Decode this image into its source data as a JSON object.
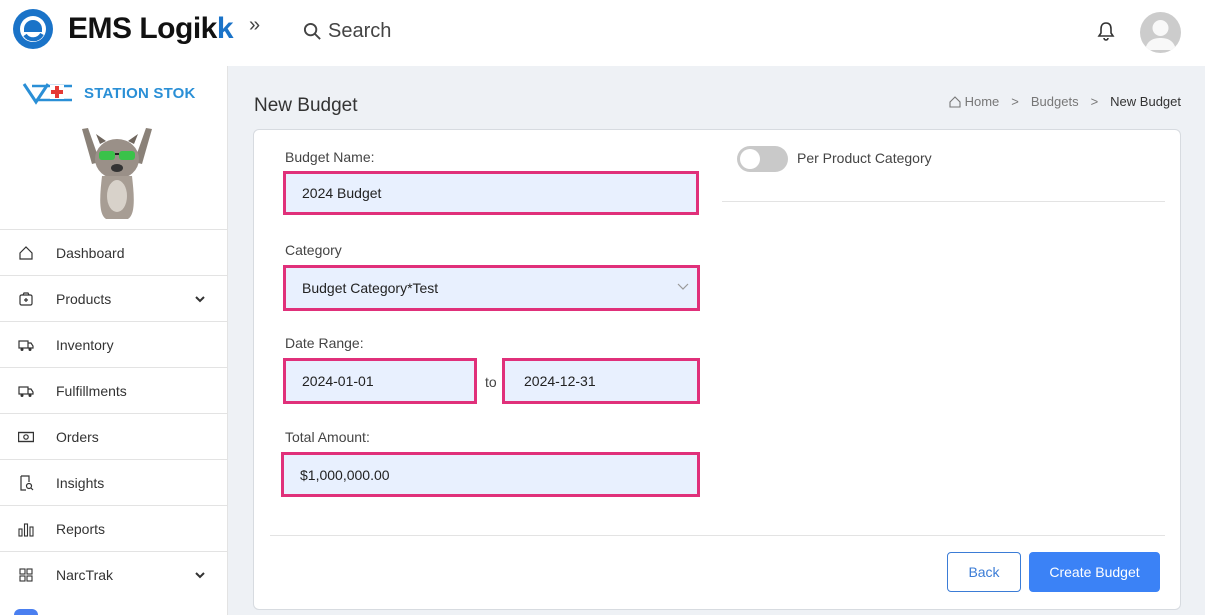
{
  "brand": {
    "name_main": "EMS",
    "name_sub": "Logik",
    "name_tail": "k"
  },
  "header": {
    "collapse_icon": "»",
    "search_placeholder": "Search"
  },
  "station": {
    "name": "STATION STOK"
  },
  "sidebar": {
    "items": [
      {
        "label": "Dashboard",
        "icon": "home-icon",
        "expandable": false
      },
      {
        "label": "Products",
        "icon": "box-icon",
        "expandable": true
      },
      {
        "label": "Inventory",
        "icon": "truck-icon",
        "expandable": false
      },
      {
        "label": "Fulfillments",
        "icon": "truck-icon",
        "expandable": false
      },
      {
        "label": "Orders",
        "icon": "money-icon",
        "expandable": false
      },
      {
        "label": "Insights",
        "icon": "report-search-icon",
        "expandable": false
      },
      {
        "label": "Reports",
        "icon": "bar-chart-icon",
        "expandable": false
      },
      {
        "label": "NarcTrak",
        "icon": "grid-icon",
        "expandable": true
      }
    ]
  },
  "page": {
    "title": "New Budget",
    "breadcrumb": {
      "home": "Home",
      "parent": "Budgets",
      "current": "New Budget",
      "separator": ">"
    }
  },
  "form": {
    "budget_name_label": "Budget Name:",
    "budget_name_value": "2024 Budget",
    "category_label": "Category",
    "category_value": "Budget Category*Test",
    "date_range_label": "Date Range:",
    "date_from": "2024-01-01",
    "date_to_separator": "to",
    "date_to": "2024-12-31",
    "total_amount_label": "Total Amount:",
    "total_amount_value": "$1,000,000.00",
    "per_product_category_label": "Per Product Category",
    "per_product_category_enabled": false
  },
  "actions": {
    "back_label": "Back",
    "create_label": "Create Budget"
  },
  "colors": {
    "accent": "#3b82f6",
    "highlight_border": "#e0307a",
    "field_bg": "#e8f0fe",
    "brand_blue": "#1a73c8"
  }
}
